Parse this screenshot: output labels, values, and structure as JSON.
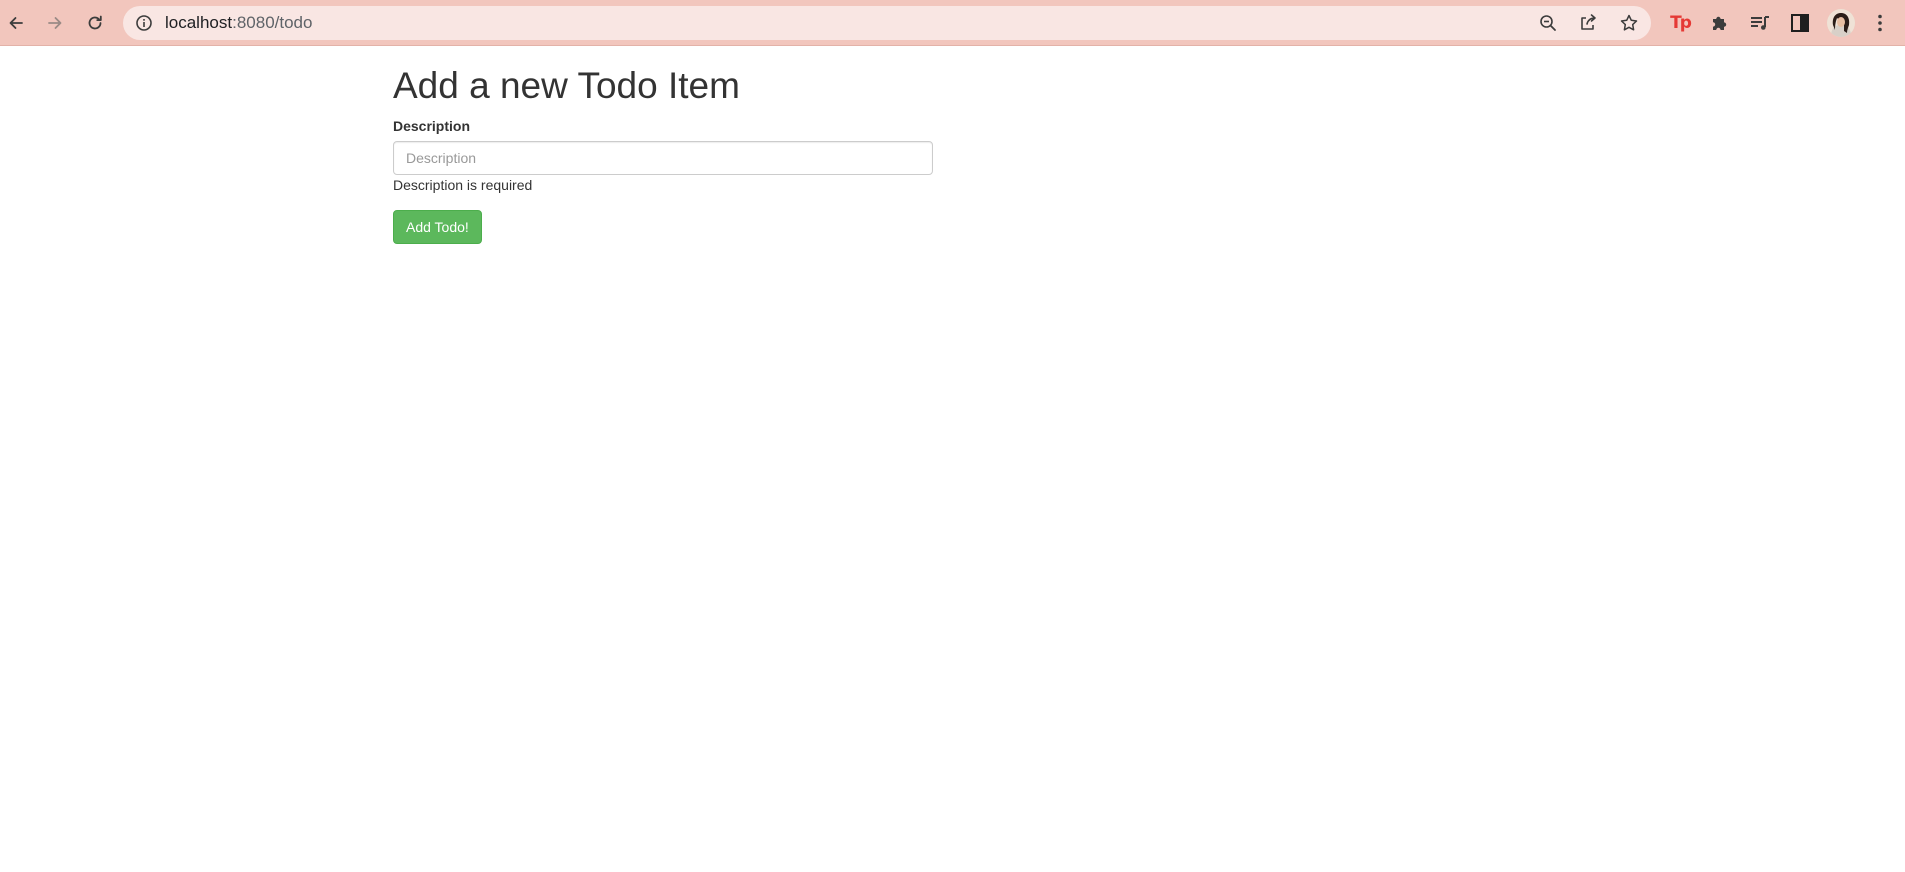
{
  "browser": {
    "url_host": "localhost",
    "url_port_path": ":8080/todo",
    "accent_color": "#f2c6bd",
    "icons": {
      "back": "arrow-left-icon",
      "forward": "arrow-right-icon",
      "reload": "reload-icon",
      "site_info": "info-circle-icon",
      "zoom": "zoom-out-icon",
      "share": "share-icon",
      "bookmark": "star-icon",
      "extension_tp": "tp-extension-icon",
      "extensions": "puzzle-icon",
      "media": "media-queue-icon",
      "side_panel": "side-panel-icon",
      "profile": "avatar",
      "menu": "kebab-menu-icon"
    },
    "tp_extension_label": "Tp"
  },
  "page": {
    "title": "Add a new Todo Item",
    "form": {
      "description_label": "Description",
      "description_value": "",
      "description_placeholder": "Description",
      "description_error": "Description is required",
      "submit_label": "Add Todo!",
      "submit_color": "#5cb85c"
    }
  }
}
